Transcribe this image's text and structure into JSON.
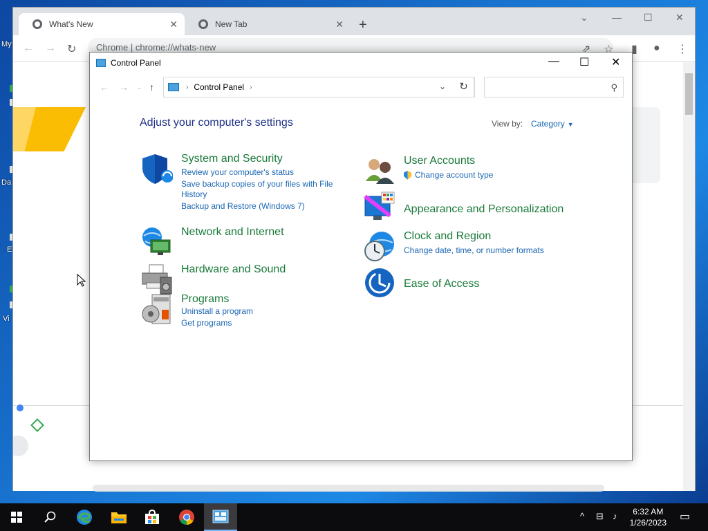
{
  "desktop": {
    "labels": [
      "My",
      "Da",
      "E",
      "Vi"
    ]
  },
  "chrome": {
    "tabs": [
      {
        "title": "What's New",
        "active": true
      },
      {
        "title": "New Tab",
        "active": false
      }
    ],
    "new_tab_symbol": "+",
    "address_text": "Chrome  |  chrome://whats-new",
    "window_controls": [
      "⌄",
      "—",
      "☐",
      "✕"
    ]
  },
  "control_panel": {
    "window_title": "Control Panel",
    "breadcrumb": "Control Panel",
    "search_placeholder": "",
    "heading": "Adjust your computer's settings",
    "view_by_label": "View by:",
    "view_by_value": "Category",
    "categories_left": [
      {
        "title": "System and Security",
        "icon": "shield-icon",
        "links": [
          "Review your computer's status",
          "Save backup copies of your files with File",
          "History",
          "Backup and Restore (Windows 7)"
        ]
      },
      {
        "title": "Network and Internet",
        "icon": "network-icon",
        "links": []
      },
      {
        "title": "Hardware and Sound",
        "icon": "printer-icon",
        "links": []
      },
      {
        "title": "Programs",
        "icon": "programs-icon",
        "links": [
          "Uninstall a program",
          "Get programs"
        ]
      }
    ],
    "categories_right": [
      {
        "title": "User Accounts",
        "icon": "users-icon",
        "links": [
          "Change account type"
        ]
      },
      {
        "title": "Appearance and Personalization",
        "icon": "display-icon",
        "links": []
      },
      {
        "title": "Clock and Region",
        "icon": "clock-icon",
        "links": [
          "Change date, time, or number formats"
        ]
      },
      {
        "title": "Ease of Access",
        "icon": "accessibility-icon",
        "links": []
      }
    ]
  },
  "taskbar": {
    "time": "6:32 AM",
    "date": "1/26/2023"
  },
  "colors": {
    "heading": "#1e3287",
    "category_title": "#1a7a3a",
    "link": "#1a66b3"
  }
}
